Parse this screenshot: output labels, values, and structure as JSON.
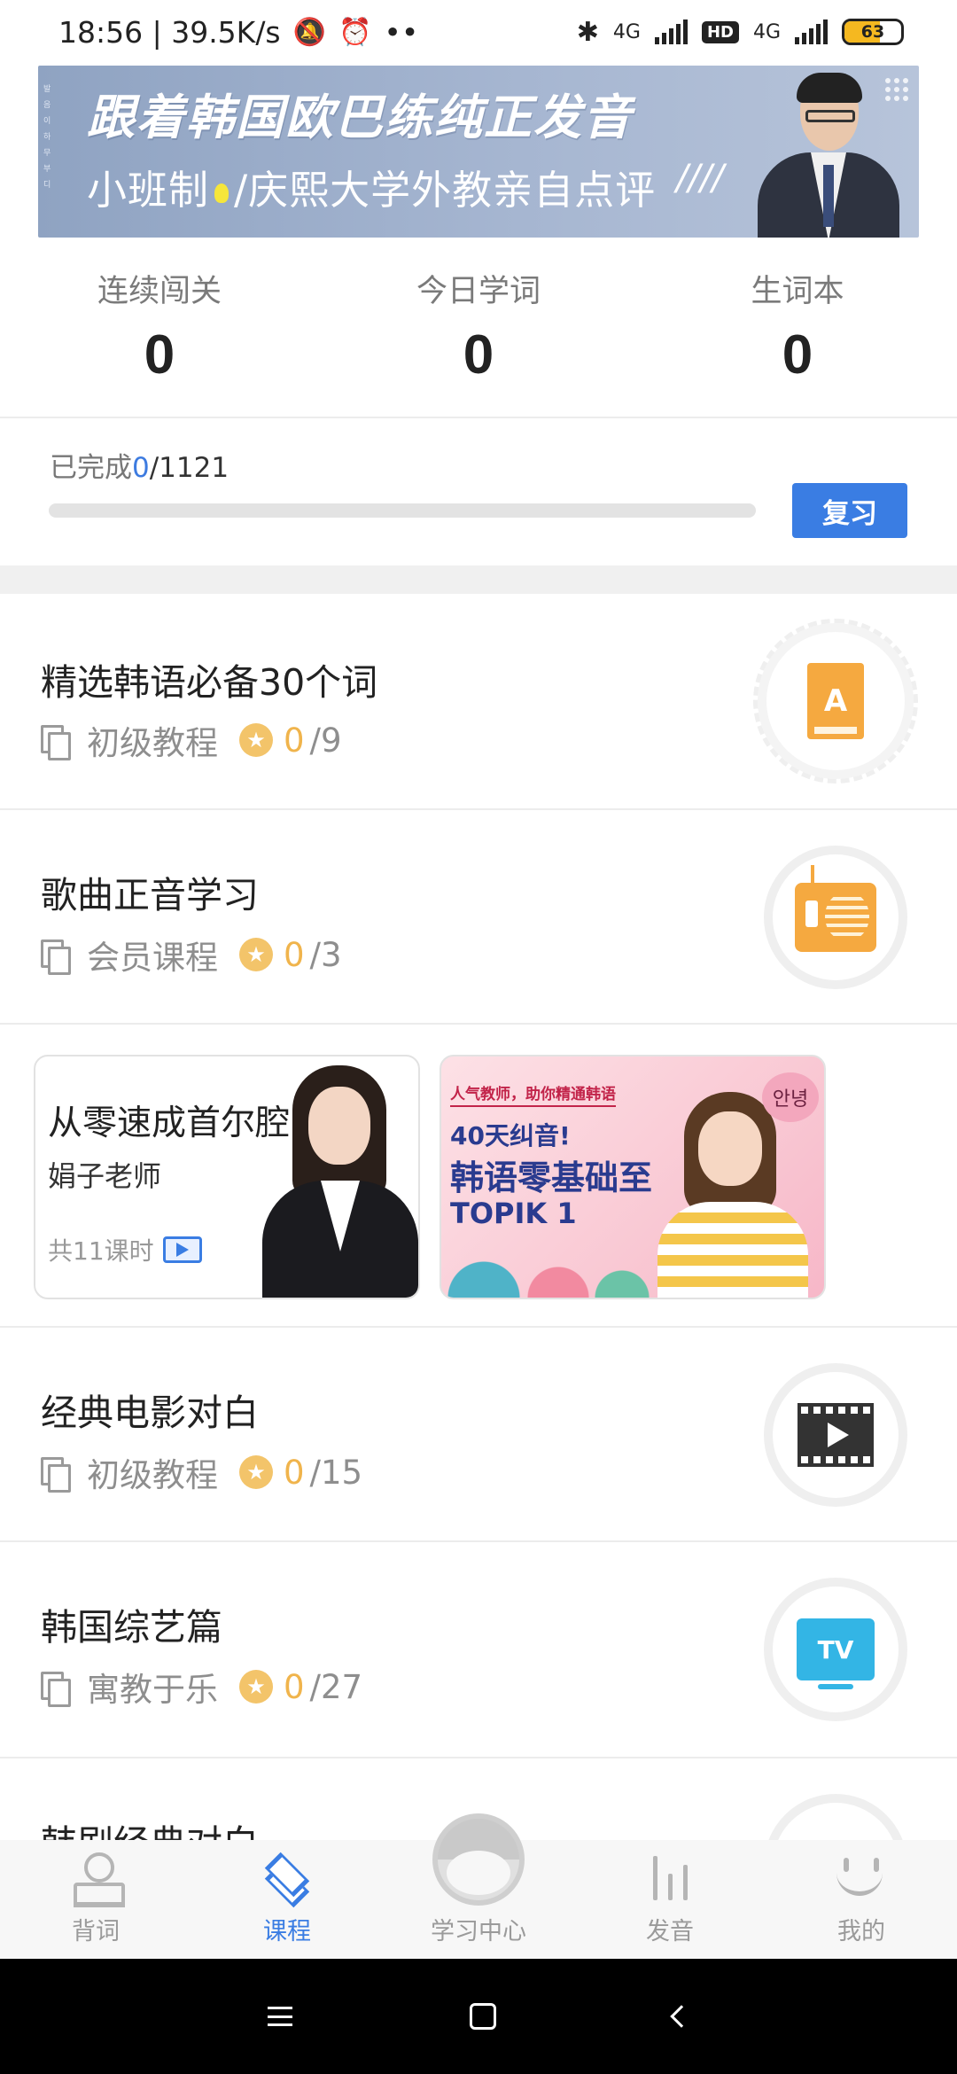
{
  "status_bar": {
    "time_speed": "18:56 | 39.5K/s",
    "dots": "••",
    "net1": "4G",
    "hd": "HD",
    "net2": "4G",
    "battery": "63",
    "battery_level": 0.63
  },
  "banner": {
    "title": "跟着韩国欧巴练纯正发音",
    "subtitle_a": "小班制",
    "subtitle_b": "/庆熙大学外教亲自点评",
    "stripes": "////",
    "side_text": "발음이하무부디"
  },
  "stats": [
    {
      "label": "连续闯关",
      "value": "0"
    },
    {
      "label": "今日学词",
      "value": "0"
    },
    {
      "label": "生词本",
      "value": "0"
    }
  ],
  "progress": {
    "label": "已完成",
    "done": "0",
    "total": "/1121",
    "fraction": 0,
    "review_label": "复习"
  },
  "courses": [
    {
      "title": "精选韩语必备30个词",
      "type": "初级教程",
      "done": "0",
      "total": "/9",
      "icon": "book-icon"
    },
    {
      "title": "歌曲正音学习",
      "type": "会员课程",
      "done": "0",
      "total": "/3",
      "icon": "radio-icon"
    },
    {
      "title": "经典电影对白",
      "type": "初级教程",
      "done": "0",
      "total": "/15",
      "icon": "film-icon"
    },
    {
      "title": "韩国综艺篇",
      "type": "寓教于乐",
      "done": "0",
      "total": "/27",
      "icon": "tv-icon"
    },
    {
      "title": "韩剧经典对白"
    }
  ],
  "promo1": {
    "title": "从零速成首尔腔",
    "teacher": "娟子老师",
    "count": "共11课时"
  },
  "promo2": {
    "top": "人气教师，助你精通韩语",
    "line1": "40天纠音!",
    "line2": "韩语零基础至",
    "line3": "TOPIK 1",
    "hello": "안녕"
  },
  "star_glyph": "★",
  "icons": {
    "book_letter": "A",
    "tv_letters": "TV"
  },
  "bottom_nav": [
    {
      "label": "背词",
      "icon": "person-icon"
    },
    {
      "label": "课程",
      "icon": "layers-icon",
      "active": true
    },
    {
      "label": "学习中心",
      "icon": "study-center-icon"
    },
    {
      "label": "发音",
      "icon": "bars-icon"
    },
    {
      "label": "我的",
      "icon": "smile-icon"
    }
  ],
  "colors": {
    "accent": "#3a7de3",
    "star": "#f3c46a",
    "orange_icon": "#f5a940",
    "tv_icon": "#33b5e5"
  }
}
